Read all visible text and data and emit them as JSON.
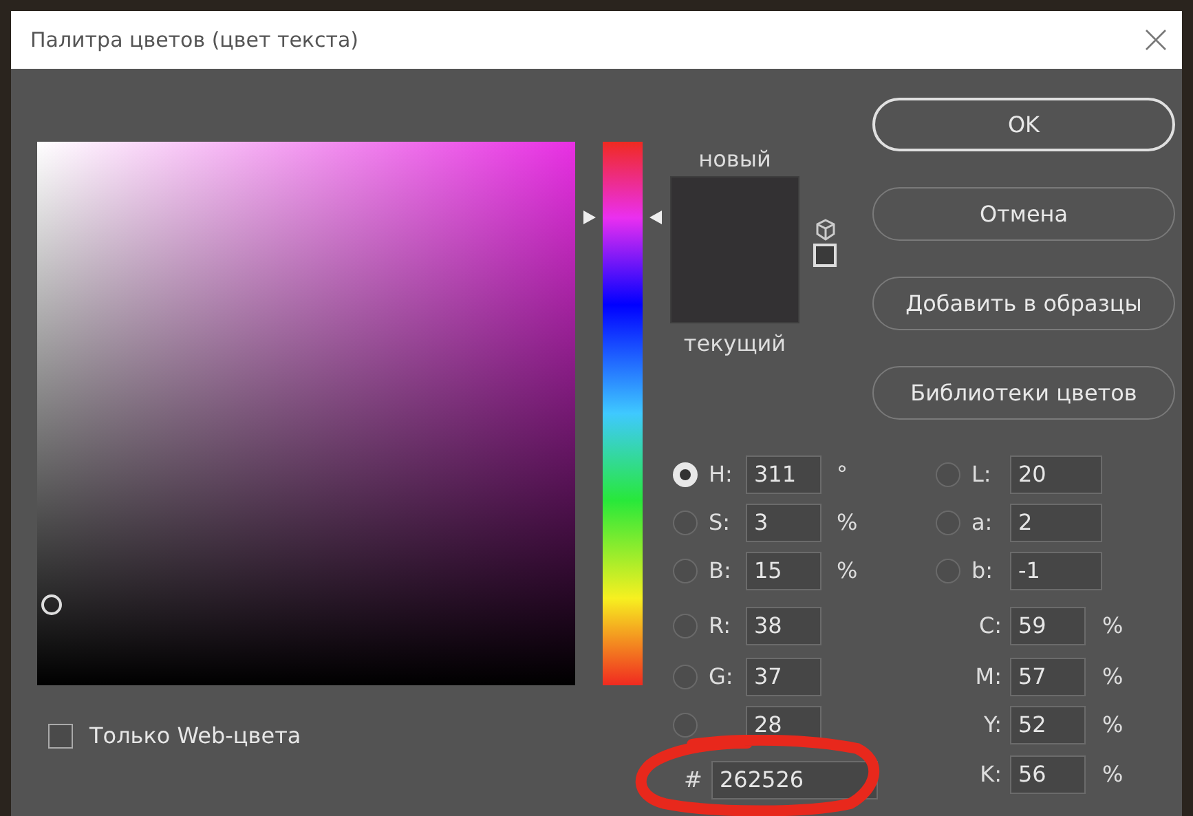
{
  "window": {
    "title": "Палитра цветов (цвет текста)"
  },
  "hue_slider": {
    "level": 0.86
  },
  "preview": {
    "new_label": "новый",
    "current_label": "текущий"
  },
  "buttons": [
    {
      "label": "OK",
      "default": true
    },
    {
      "label": "Отмена",
      "default": false
    },
    {
      "label": "Добавить в образцы",
      "default": false
    },
    {
      "label": "Библиотеки цветов",
      "default": false
    }
  ],
  "web_colors_only": {
    "label": "Только Web-цвета",
    "checked": false
  },
  "hsb": [
    {
      "label": "H:",
      "value": "311",
      "unit": "°",
      "selected": true
    },
    {
      "label": "S:",
      "value": "3",
      "unit": "%",
      "selected": false
    },
    {
      "label": "B:",
      "value": "15",
      "unit": "%",
      "selected": false
    }
  ],
  "rgb": [
    {
      "label": "R:",
      "value": "38",
      "selected": false
    },
    {
      "label": "G:",
      "value": "37",
      "selected": false
    },
    {
      "value": "28",
      "selected": false
    }
  ],
  "hex": {
    "label": "#",
    "value": "262526"
  },
  "lab": [
    {
      "label": "L:",
      "value": "20",
      "selected": false
    },
    {
      "label": "a:",
      "value": "2",
      "selected": false
    },
    {
      "label": "b:",
      "value": "-1",
      "selected": false
    }
  ],
  "cmyk": [
    {
      "label": "C:",
      "value": "59",
      "unit": "%"
    },
    {
      "label": "M:",
      "value": "57",
      "unit": "%"
    },
    {
      "label": "Y:",
      "value": "52",
      "unit": "%"
    },
    {
      "label": "K:",
      "value": "56",
      "unit": "%"
    }
  ]
}
